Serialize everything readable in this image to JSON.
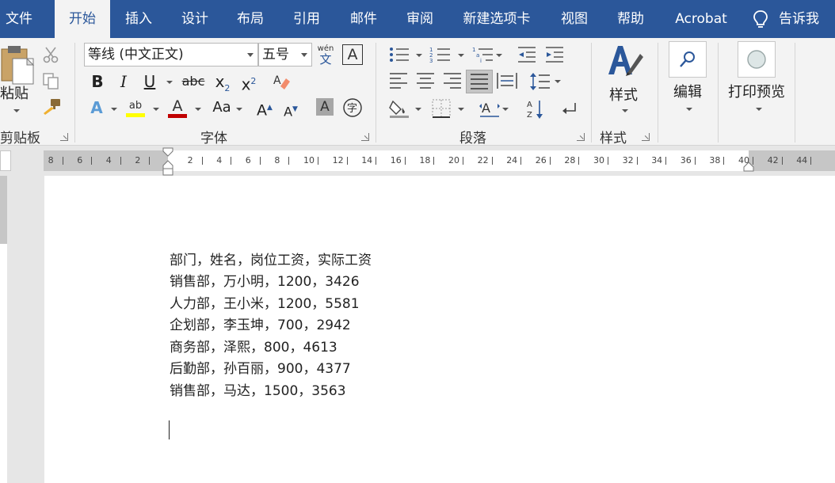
{
  "ribbon_tabs": [
    "文件",
    "开始",
    "插入",
    "设计",
    "布局",
    "引用",
    "邮件",
    "审阅",
    "新建选项卡",
    "视图",
    "帮助",
    "Acrobat"
  ],
  "tell_me": "告诉我",
  "clipboard": {
    "paste_label": "粘贴",
    "group_label": "剪贴板"
  },
  "font": {
    "name": "等线 (中文正文)",
    "size": "五号",
    "phonetic_top": "wén",
    "phonetic_bottom": "文",
    "border_char": "A",
    "group_label": "字体"
  },
  "paragraph": {
    "group_label": "段落"
  },
  "styles": {
    "label": "样式",
    "group_label": "样式"
  },
  "editing": {
    "label": "编辑"
  },
  "print_preview": {
    "label": "打印预览"
  },
  "ruler": {
    "left_numbers": [
      "8",
      "6",
      "4",
      "2"
    ],
    "right_numbers": [
      "2",
      "4",
      "6",
      "8",
      "10",
      "12",
      "14",
      "16",
      "18",
      "20",
      "22",
      "24",
      "26",
      "28",
      "30",
      "32",
      "34",
      "36",
      "38",
      "40",
      "42",
      "44"
    ]
  },
  "document": {
    "lines": [
      "部门，姓名，岗位工资，实际工资",
      "销售部，万小明，1200，3426",
      "人力部，王小米，1200，5581",
      "企划部，李玉坤，700，2942",
      "商务部，泽熙，800，4613",
      "后勤部，孙百丽，900，4377",
      "销售部，马达，1500，3563"
    ]
  },
  "colors": {
    "ribbon_blue": "#2b579a",
    "highlight_yellow": "#ffff00",
    "font_red": "#c00000"
  }
}
